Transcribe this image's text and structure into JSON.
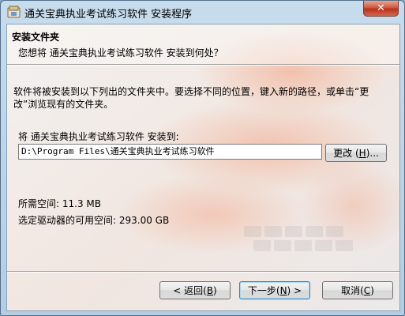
{
  "window": {
    "title": "通关宝典执业考试练习软件 安装程序",
    "close_glyph": "✕"
  },
  "header": {
    "title": "安装文件夹",
    "subtitle": "您想将 通关宝典执业考试练习软件 安装到何处？"
  },
  "body": {
    "description": "软件将被安装到以下列出的文件夹中。要选择不同的位置，键入新的路径，或单击“更改”浏览现有的文件夹。",
    "destination_label": "将 通关宝典执业考试练习软件 安装到:",
    "destination_path": "D:\\Program Files\\通关宝典执业考试练习软件",
    "browse_button": {
      "prefix": "更改 (",
      "hotkey": "H",
      "suffix": ")..."
    },
    "space_required": "所需空间: 11.3 MB",
    "space_available": "选定驱动器的可用空间: 293.00 GB"
  },
  "footer": {
    "back_button": {
      "prefix": "< 返回(",
      "hotkey": "B",
      "suffix": ")"
    },
    "next_button": {
      "prefix": "下一步(",
      "hotkey": "N",
      "suffix": ") >"
    },
    "cancel_button": {
      "prefix": "取消(",
      "hotkey": "C",
      "suffix": ")"
    }
  },
  "colors": {
    "titlebar": "#b8d1e5",
    "close_button": "#c7412b",
    "dialog_bg": "#f0f0f0",
    "default_button_border": "#3c7fb1"
  }
}
